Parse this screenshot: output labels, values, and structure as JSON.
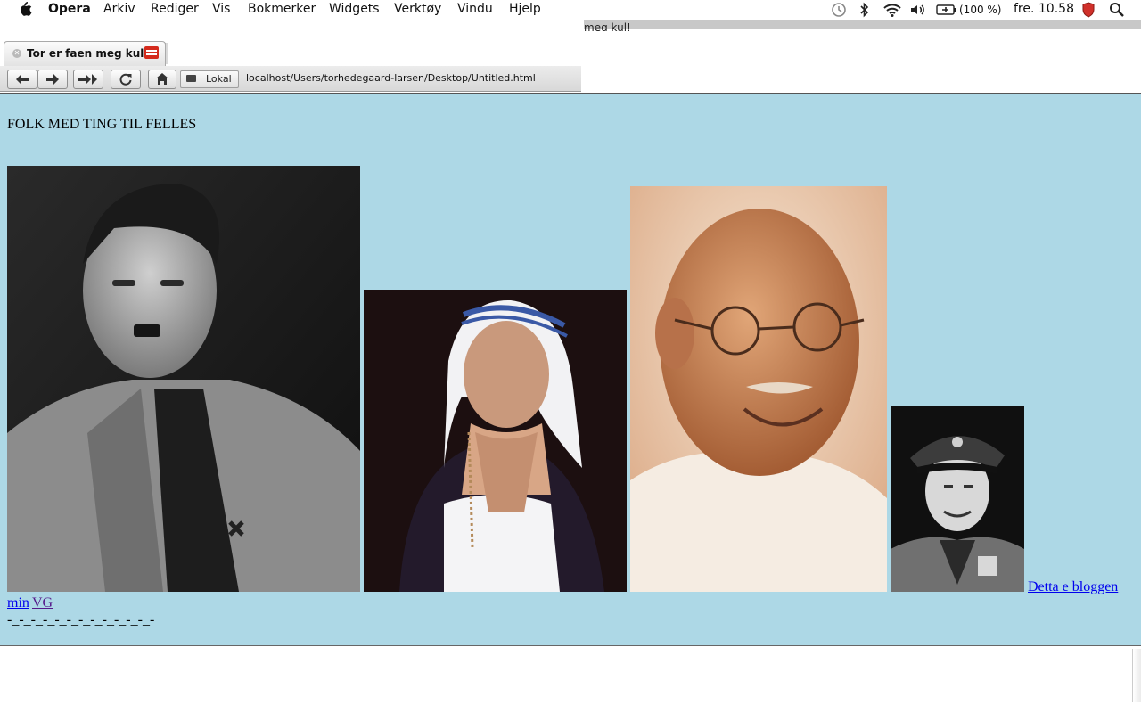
{
  "menubar": {
    "app": "Opera",
    "items": [
      "Arkiv",
      "Rediger",
      "Vis",
      "Bokmerker",
      "Widgets",
      "Verktøy",
      "Vindu",
      "Hjelp"
    ],
    "battery": "(100 %)",
    "clock": "fre. 10.58"
  },
  "background_window_text": "meg kul!",
  "tab": {
    "title": "Tor er faen meg kul!"
  },
  "navbar": {
    "lokal_label": "Lokal",
    "url": "localhost/Users/torhedegaard-larsen/Desktop/Untitled.html"
  },
  "page": {
    "heading": "FOLK MED TING TIL FELLES",
    "photos": [
      {
        "name": "photo-man-uniform-1",
        "icon": "portrait-photo"
      },
      {
        "name": "photo-nun-praying",
        "icon": "portrait-photo"
      },
      {
        "name": "photo-bald-man-glasses",
        "icon": "portrait-photo"
      },
      {
        "name": "photo-officer-cap",
        "icon": "portrait-photo"
      }
    ],
    "link_blog": "Detta e bloggen",
    "link_min": "min",
    "link_vg": "VG",
    "dashes": "-_-_-_-_-_-_-_-_-_-_-_-_-"
  },
  "colors": {
    "page_background": "#add8e6",
    "link": "#0000ee",
    "visited_link": "#551a8b"
  }
}
